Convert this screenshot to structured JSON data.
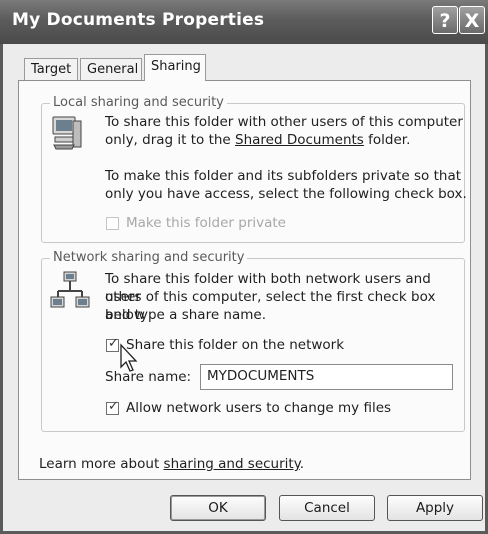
{
  "window": {
    "title": "My Documents Properties",
    "help_label": "?",
    "close_label": "X"
  },
  "tabs": [
    {
      "label": "Target"
    },
    {
      "label": "General"
    },
    {
      "label": "Sharing"
    }
  ],
  "local": {
    "legend": "Local sharing and security",
    "icon": "computer-icon",
    "line1": "To share this folder with other users of this computer",
    "line2_pre": "only, drag it to the ",
    "line2_link": "Shared Documents",
    "line2_post": " folder.",
    "line3": "To make this folder and its subfolders private so that",
    "line4": "only you have access, select the following check box.",
    "private_label": "Make this folder private",
    "private_checked": false
  },
  "network": {
    "legend": "Network sharing and security",
    "icon": "network-icon",
    "line1": "To share this folder with both network users and other",
    "line2": "users of this computer, select the first check box below",
    "line3": "and type a share name.",
    "share_label": "Share this folder on the network",
    "share_checked": true,
    "share_name_label": "Share name:",
    "share_name_value": "MYDOCUMENTS",
    "allow_label": "Allow network users to change my files",
    "allow_checked": true
  },
  "learn": {
    "pre": "Learn more about ",
    "link": "sharing and security",
    "post": "."
  },
  "buttons": {
    "ok": "OK",
    "cancel": "Cancel",
    "apply": "Apply"
  }
}
